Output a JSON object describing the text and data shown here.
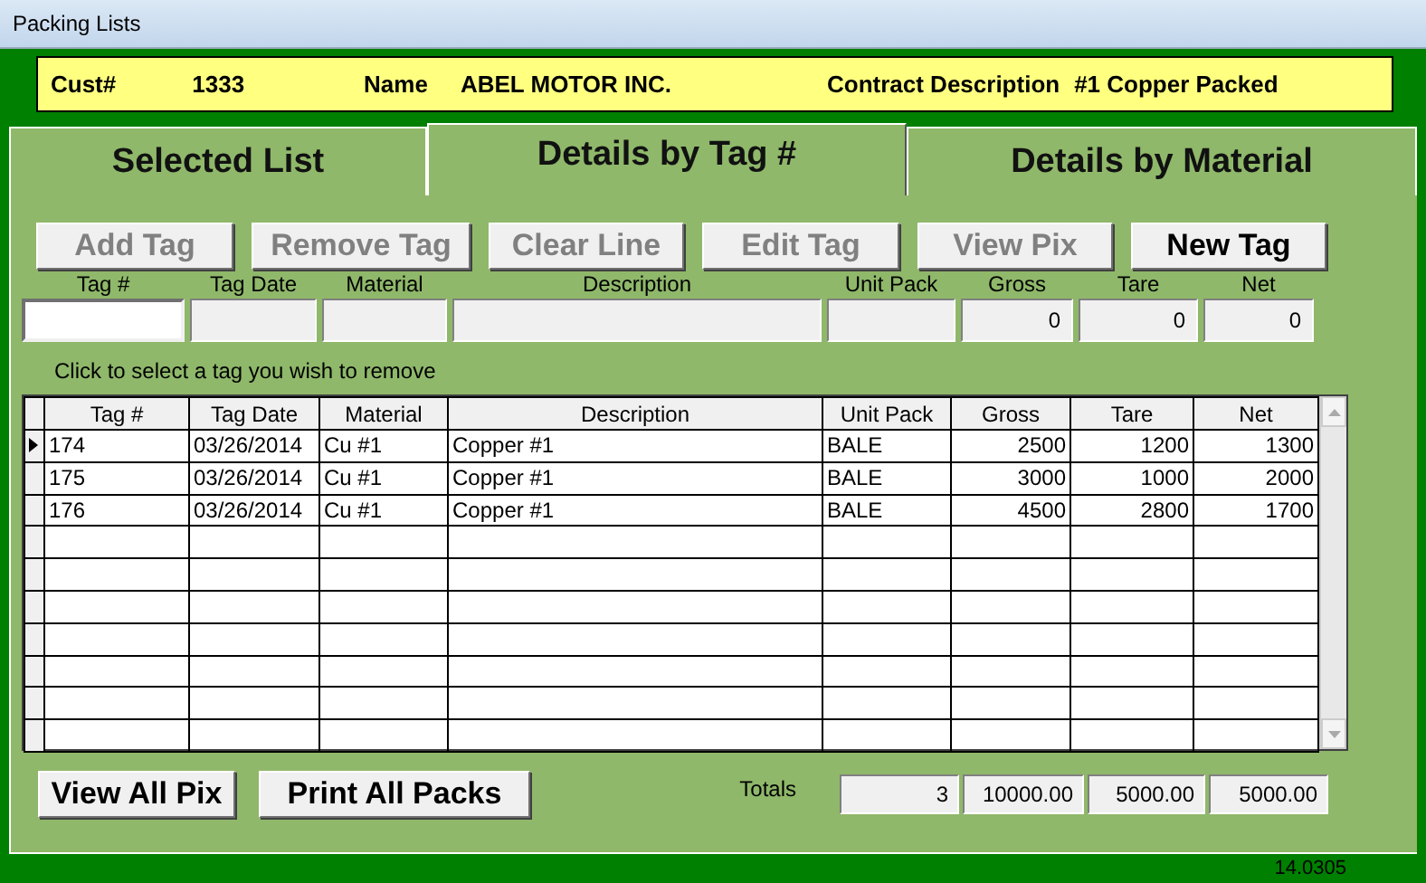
{
  "window": {
    "title": "Packing Lists"
  },
  "header": {
    "cust_label": "Cust#",
    "cust": "1333",
    "name_label": "Name",
    "name": "ABEL MOTOR INC.",
    "contract_label": "Contract Description",
    "contract": "#1 Copper Packed"
  },
  "tabs": [
    {
      "label": "Selected List",
      "selected": false
    },
    {
      "label": "Details by Tag #",
      "selected": true
    },
    {
      "label": "Details by Material",
      "selected": false
    }
  ],
  "toolbar": [
    {
      "label": "Add Tag",
      "disabled": true
    },
    {
      "label": "Remove Tag",
      "disabled": true
    },
    {
      "label": "Clear Line",
      "disabled": true
    },
    {
      "label": "Edit Tag",
      "disabled": true
    },
    {
      "label": "View Pix",
      "disabled": true
    },
    {
      "label": "New Tag",
      "disabled": false
    }
  ],
  "entry_fields": [
    {
      "label": "Tag #",
      "disabled": false
    },
    {
      "label": "Tag Date",
      "disabled": true
    },
    {
      "label": "Material",
      "disabled": true
    },
    {
      "label": "Description",
      "disabled": true
    },
    {
      "label": "Unit Pack",
      "disabled": true
    },
    {
      "label": "Gross",
      "value": "0",
      "disabled": true
    },
    {
      "label": "Tare",
      "value": "0",
      "disabled": true
    },
    {
      "label": "Net",
      "value": "0",
      "disabled": true
    }
  ],
  "hint": "Click to select a tag you wish to remove",
  "table": {
    "columns": [
      {
        "label": "Tag #"
      },
      {
        "label": "Tag Date"
      },
      {
        "label": "Material"
      },
      {
        "label": "Description"
      },
      {
        "label": "Unit Pack"
      },
      {
        "label": "Gross"
      },
      {
        "label": "Tare"
      },
      {
        "label": "Net"
      }
    ],
    "rows": [
      {
        "current": true,
        "cells": [
          "174",
          "03/26/2014",
          "Cu #1",
          "Copper #1",
          "BALE",
          "2500",
          "1200",
          "1300"
        ]
      },
      {
        "current": false,
        "cells": [
          "175",
          "03/26/2014",
          "Cu #1",
          "Copper #1",
          "BALE",
          "3000",
          "1000",
          "2000"
        ]
      },
      {
        "current": false,
        "cells": [
          "176",
          "03/26/2014",
          "Cu #1",
          "Copper #1",
          "BALE",
          "4500",
          "2800",
          "1700"
        ]
      }
    ]
  },
  "bottom_buttons": [
    {
      "label": "View All Pix",
      "disabled": false
    },
    {
      "label": "Print All Packs",
      "disabled": false
    }
  ],
  "totals": {
    "label": "Totals",
    "values": [
      "3",
      "10000.00",
      "5000.00",
      "5000.00"
    ]
  },
  "status_bar": {
    "version": "14.0305"
  }
}
